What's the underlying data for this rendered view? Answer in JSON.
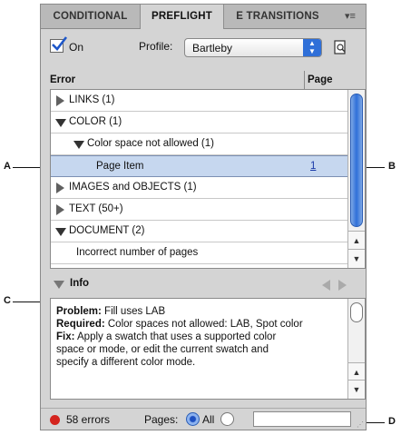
{
  "tabs": [
    {
      "label": "CONDITIONAL",
      "active": false
    },
    {
      "label": "PREFLIGHT",
      "active": true
    },
    {
      "label": "E TRANSITIONS",
      "active": false
    }
  ],
  "toolbar": {
    "on_label": "On",
    "on_checked": true,
    "profile_label": "Profile:",
    "profile_value": "Bartleby"
  },
  "columns": {
    "error": "Error",
    "page": "Page"
  },
  "errors": [
    {
      "label": "LINKS (1)",
      "state": "collapsed",
      "indent": 0,
      "page": ""
    },
    {
      "label": "COLOR (1)",
      "state": "expanded",
      "indent": 0,
      "page": ""
    },
    {
      "label": "Color space not allowed (1)",
      "state": "expanded",
      "indent": 1,
      "page": ""
    },
    {
      "label": "Page Item",
      "state": "leaf",
      "indent": 2,
      "page": "1",
      "selected": true
    },
    {
      "label": "IMAGES and OBJECTS (1)",
      "state": "collapsed",
      "indent": 0,
      "page": ""
    },
    {
      "label": "TEXT (50+)",
      "state": "collapsed",
      "indent": 0,
      "page": ""
    },
    {
      "label": "DOCUMENT (2)",
      "state": "expanded",
      "indent": 0,
      "page": ""
    },
    {
      "label": "Incorrect number of pages",
      "state": "leaf",
      "indent": 1,
      "page": ""
    }
  ],
  "info": {
    "title": "Info",
    "problem_label": "Problem:",
    "problem_text": " Fill uses LAB",
    "required_label": "Required:",
    "required_text": " Color spaces not allowed: LAB, Spot color",
    "fix_label": "Fix:",
    "fix_line1": " Apply a swatch that uses a supported color",
    "fix_line2": "space or mode, or edit the current swatch and",
    "fix_line3": "specify a different color mode."
  },
  "status": {
    "error_count": "58 errors",
    "pages_label": "Pages:",
    "all_label": "All",
    "pages_value": "",
    "status_color": "#d4241e"
  },
  "callouts": {
    "a": "A",
    "b": "B",
    "c": "C",
    "d": "D"
  }
}
